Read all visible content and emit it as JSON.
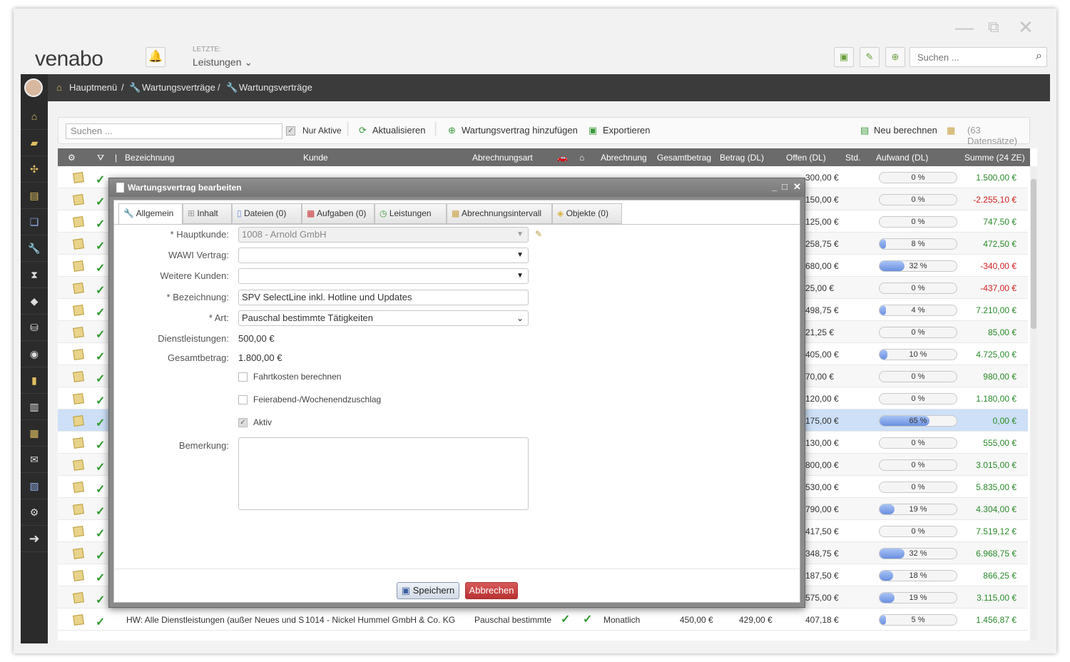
{
  "app": {
    "logo": "venabo",
    "letzte_label": "LETZTE:",
    "letzte_value": "Leistungen",
    "search_placeholder": "Suchen ..."
  },
  "breadcrumb": [
    {
      "label": "Hauptmenü"
    },
    {
      "label": "Wartungsverträge"
    },
    {
      "label": "Wartungsverträge"
    }
  ],
  "toolbar": {
    "search_placeholder": "Suchen ...",
    "nur_aktive": "Nur Aktive",
    "aktualisieren": "Aktualisieren",
    "hinzufuegen": "Wartungsvertrag hinzufügen",
    "exportieren": "Exportieren",
    "neu_berechnen": "Neu berechnen",
    "count": "(63 Datensätze)"
  },
  "columns": {
    "bezeichnung": "Bezeichnung",
    "kunde": "Kunde",
    "abrechnungsart": "Abrechnungsart",
    "abrechnung": "Abrechnung",
    "gesamtbetrag": "Gesamtbetrag",
    "betrag": "Betrag (DL)",
    "offen": "Offen (DL)",
    "std": "Std.",
    "aufwand": "Aufwand (DL)",
    "summe": "Summe (24 ZE)"
  },
  "rows": [
    {
      "offen": "300,00 €",
      "aufwand": 0,
      "aufwand_label": "0 %",
      "summe": "1.500,00 €",
      "neg": false
    },
    {
      "offen": "150,00 €",
      "aufwand": 0,
      "aufwand_label": "0 %",
      "summe": "-2.255,10 €",
      "neg": true
    },
    {
      "offen": "125,00 €",
      "aufwand": 0,
      "aufwand_label": "0 %",
      "summe": "747,50 €",
      "neg": false
    },
    {
      "offen": "258,75 €",
      "aufwand": 8,
      "aufwand_label": "8 %",
      "summe": "472,50 €",
      "neg": false
    },
    {
      "offen": "680,00 €",
      "aufwand": 32,
      "aufwand_label": "32 %",
      "summe": "-340,00 €",
      "neg": true
    },
    {
      "offen": "25,00 €",
      "aufwand": 0,
      "aufwand_label": "0 %",
      "summe": "-437,00 €",
      "neg": true
    },
    {
      "offen": "498,75 €",
      "aufwand": 4,
      "aufwand_label": "4 %",
      "summe": "7.210,00 €",
      "neg": false
    },
    {
      "offen": "21,25 €",
      "aufwand": 0,
      "aufwand_label": "0 %",
      "summe": "85,00 €",
      "neg": false
    },
    {
      "offen": "405,00 €",
      "aufwand": 10,
      "aufwand_label": "10 %",
      "summe": "4.725,00 €",
      "neg": false
    },
    {
      "offen": "70,00 €",
      "aufwand": 0,
      "aufwand_label": "0 %",
      "summe": "980,00 €",
      "neg": false
    },
    {
      "offen": "120,00 €",
      "aufwand": 0,
      "aufwand_label": "0 %",
      "summe": "1.180,00 €",
      "neg": false
    },
    {
      "offen": "175,00 €",
      "aufwand": 65,
      "aufwand_label": "65 %",
      "summe": "0,00 €",
      "neg": false,
      "selected": true
    },
    {
      "offen": "130,00 €",
      "aufwand": 0,
      "aufwand_label": "0 %",
      "summe": "555,00 €",
      "neg": false
    },
    {
      "offen": "800,00 €",
      "aufwand": 0,
      "aufwand_label": "0 %",
      "summe": "3.015,00 €",
      "neg": false
    },
    {
      "offen": "530,00 €",
      "aufwand": 0,
      "aufwand_label": "0 %",
      "summe": "5.835,00 €",
      "neg": false
    },
    {
      "offen": "790,00 €",
      "aufwand": 19,
      "aufwand_label": "19 %",
      "summe": "4.304,00 €",
      "neg": false
    },
    {
      "offen": "417,50 €",
      "aufwand": 0,
      "aufwand_label": "0 %",
      "summe": "7.519,12 €",
      "neg": false
    },
    {
      "offen": "348,75 €",
      "aufwand": 32,
      "aufwand_label": "32 %",
      "summe": "6.968,75 €",
      "neg": false
    },
    {
      "offen": "187,50 €",
      "aufwand": 18,
      "aufwand_label": "18 %",
      "summe": "866,25 €",
      "neg": false
    },
    {
      "offen": "575,00 €",
      "aufwand": 19,
      "aufwand_label": "19 %",
      "summe": "3.115,00 €",
      "neg": false
    },
    {
      "bezeichnung": "HW: Alle Dienstleistungen (außer Neues und S",
      "kunde": "1014 - Nickel Hummel GmbH & Co. KG",
      "abrechnungsart": "Pauschal bestimmte",
      "abrechnung": "Monatlich",
      "gesamtbetrag": "450,00 €",
      "betrag": "429,00 €",
      "offen": "407,18 €",
      "aufwand": 5,
      "aufwand_label": "5 %",
      "summe": "1.456,87 €",
      "neg": false
    }
  ],
  "dialog": {
    "title": "Wartungsvertrag bearbeiten",
    "tabs": [
      "Allgemein",
      "Inhalt",
      "Dateien (0)",
      "Aufgaben (0)",
      "Leistungen",
      "Abrechnungsintervall",
      "Objekte (0)"
    ],
    "labels": {
      "hauptkunde": "* Hauptkunde:",
      "wawi": "WAWI Vertrag:",
      "weitere": "Weitere Kunden:",
      "bezeichnung": "* Bezeichnung:",
      "art": "* Art:",
      "dienstleistungen": "Dienstleistungen:",
      "gesamtbetrag": "Gesamtbetrag:",
      "bemerkung": "Bemerkung:"
    },
    "values": {
      "hauptkunde": "1008 - Arnold GmbH",
      "wawi": "",
      "weitere": "",
      "bezeichnung": "SPV SelectLine inkl. Hotline und Updates",
      "art": "Pauschal bestimmte Tätigkeiten",
      "dienstleistungen": "500,00 €",
      "gesamtbetrag": "1.800,00 €"
    },
    "checkboxes": {
      "fahrtkosten": "Fahrtkosten berechnen",
      "feierabend": "Feierabend-/Wochenendzuschlag",
      "aktiv": "Aktiv"
    },
    "save": "Speichern",
    "cancel": "Abbrechen"
  },
  "colors": {
    "positive": "#2a8a2a",
    "negative": "#d02020",
    "accent": "#6a8fe0",
    "cancel": "#b83232"
  }
}
